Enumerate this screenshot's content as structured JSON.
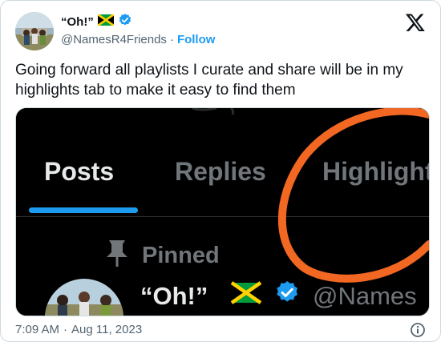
{
  "author": {
    "display_name": "“Oh!”",
    "handle": "@NamesR4Friends",
    "separator": "·",
    "follow_label": "Follow"
  },
  "tweet": {
    "text": "Going forward all playlists I curate and share will be in my highlights tab to make it easy to find them"
  },
  "media": {
    "tabs": [
      "Posts",
      "Replies",
      "Highlights"
    ],
    "pinned_label": "Pinned",
    "embedded_name": "“Oh!”",
    "embedded_handle": "@Names",
    "colors": {
      "circle": "#f26722",
      "tab_underline": "#1d9bf0",
      "verified": "#1d9bf0"
    }
  },
  "meta": {
    "time": "7:09 AM",
    "separator": "·",
    "date": "Aug 11, 2023"
  },
  "icons": {
    "flag": "jamaica-flag-icon",
    "verified": "verified-badge-icon",
    "logo": "x-logo-icon",
    "info": "info-icon",
    "pin": "pin-icon"
  },
  "colors": {
    "text": "#0f1419",
    "secondary": "#536471",
    "link": "#1d9bf0",
    "border": "#cfd9de"
  }
}
